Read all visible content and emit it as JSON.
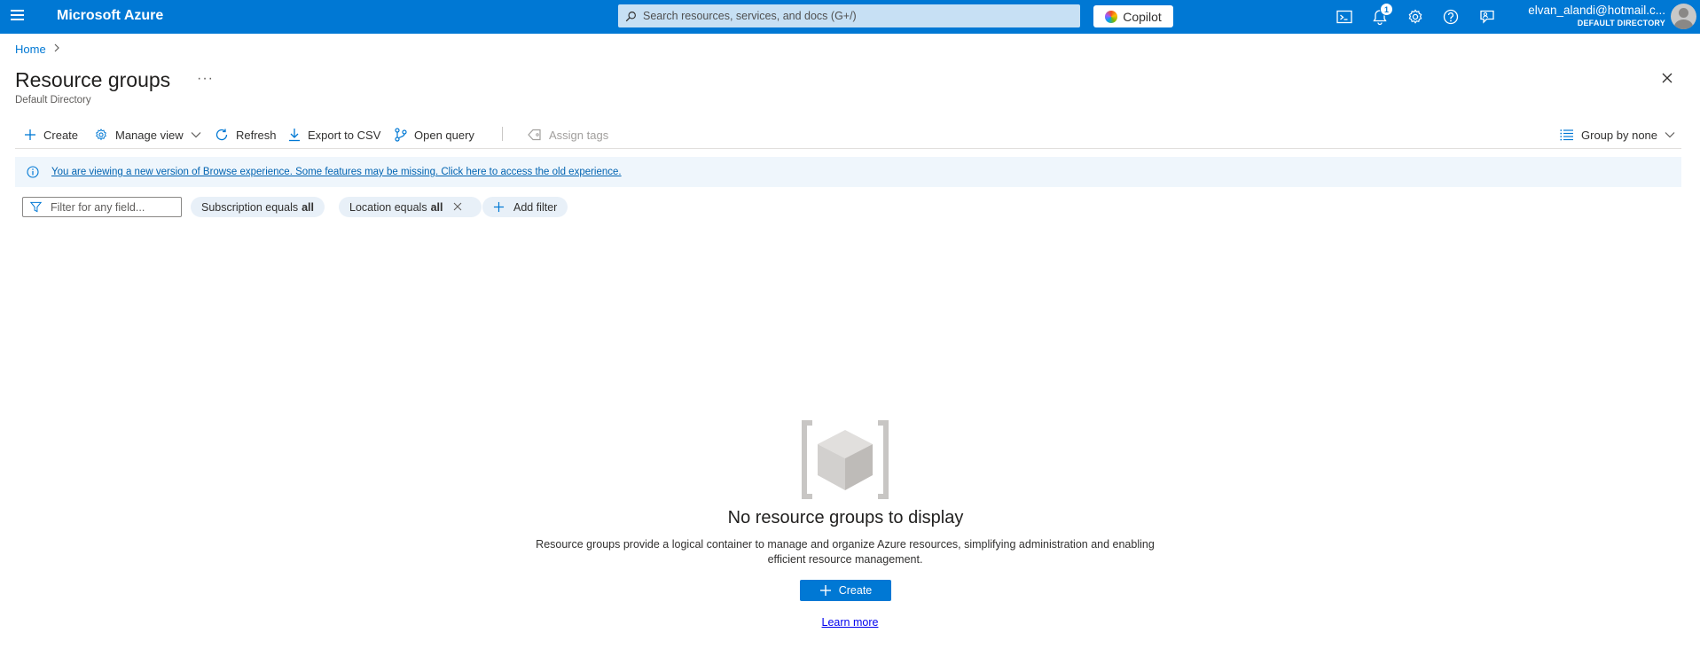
{
  "topbar": {
    "brand": "Microsoft Azure",
    "search_placeholder": "Search resources, services, and docs (G+/)",
    "copilot_label": "Copilot",
    "notifications_count": "1",
    "account_email": "elvan_alandi@hotmail.c...",
    "account_directory": "DEFAULT DIRECTORY",
    "icons": [
      "cloud-shell-icon",
      "notifications-icon",
      "settings-icon",
      "help-icon",
      "feedback-icon"
    ]
  },
  "breadcrumb": {
    "home": "Home"
  },
  "page": {
    "title": "Resource groups",
    "subtitle": "Default Directory",
    "more": "···"
  },
  "toolbar": {
    "create": "Create",
    "manage_view": "Manage view",
    "refresh": "Refresh",
    "export_csv": "Export to CSV",
    "open_query": "Open query",
    "assign_tags": "Assign tags",
    "group_by": "Group by none"
  },
  "banner": {
    "text": "You are viewing a new version of Browse experience. Some features may be missing. Click here to access the old experience."
  },
  "filters": {
    "placeholder": "Filter for any field...",
    "subscription_label": "Subscription equals",
    "subscription_value": "all",
    "location_label": "Location equals",
    "location_value": "all",
    "add_filter": "Add filter"
  },
  "empty_state": {
    "title": "No resource groups to display",
    "description": "Resource groups provide a logical container to manage and organize Azure resources, simplifying administration and enabling efficient resource management.",
    "create_button": "Create",
    "learn_more": "Learn more"
  },
  "colors": {
    "brand": "#0078d4",
    "banner_bg": "#eff6fc",
    "pill_bg": "#e8f0f8"
  }
}
